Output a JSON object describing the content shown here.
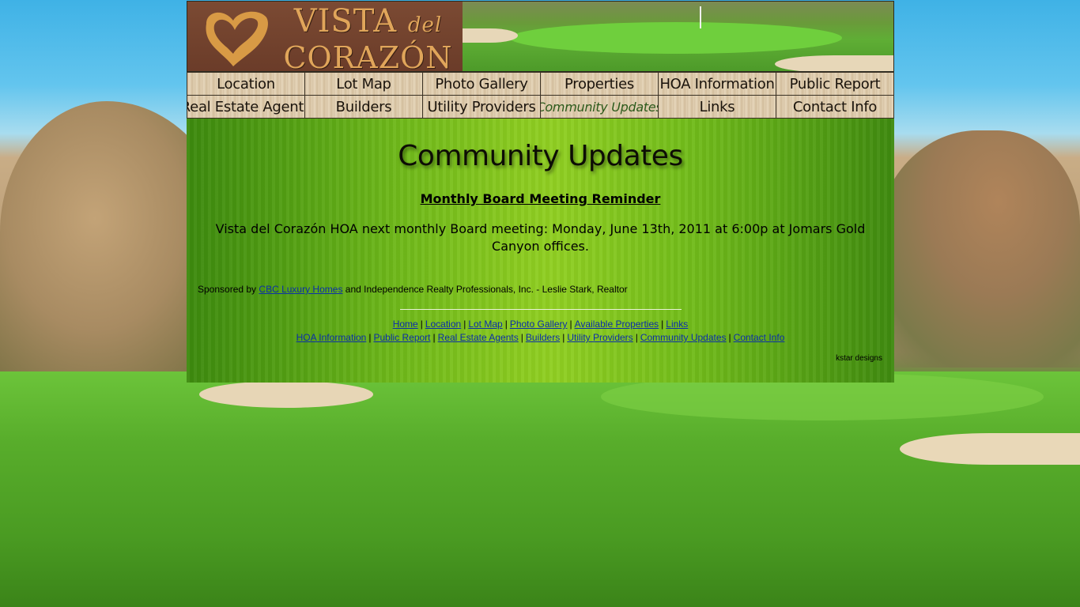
{
  "site": {
    "logo_line1": "VISTA",
    "logo_del": "del",
    "logo_line2": "CORAZÓN"
  },
  "nav": {
    "items": [
      {
        "label": "Location"
      },
      {
        "label": "Lot Map"
      },
      {
        "label": "Photo Gallery"
      },
      {
        "label": "Properties"
      },
      {
        "label": "HOA Information"
      },
      {
        "label": "Public Report"
      },
      {
        "label": "Real Estate Agents"
      },
      {
        "label": "Builders"
      },
      {
        "label": "Utility Providers"
      },
      {
        "label": "Community Updates",
        "active": true
      },
      {
        "label": "Links"
      },
      {
        "label": "Contact Info"
      }
    ]
  },
  "main": {
    "title": "Community Updates",
    "update_heading": "Monthly Board Meeting Reminder",
    "update_body": "Vista del Corazón HOA next monthly Board meeting: Monday, June 13th, 2011 at 6:00p at Jomars Gold Canyon offices."
  },
  "sponsor": {
    "prefix": "Sponsored by",
    "link": "CBC Luxury Homes",
    "suffix": "and Independence Realty Professionals, Inc. - Leslie Stark, Realtor"
  },
  "footer": {
    "row1": [
      "Home",
      "Location",
      "Lot Map",
      "Photo Gallery",
      "Available Properties",
      "Links"
    ],
    "row2": [
      "HOA Information",
      "Public Report",
      "Real Estate Agents",
      "Builders",
      "Utility Providers",
      "Community Updates",
      "Contact Info"
    ],
    "separator": "|",
    "credit": "kstar designs"
  },
  "colors": {
    "link": "#0b2fa8",
    "logo_text": "#e0a55a",
    "content_green": "#8ccc20"
  }
}
